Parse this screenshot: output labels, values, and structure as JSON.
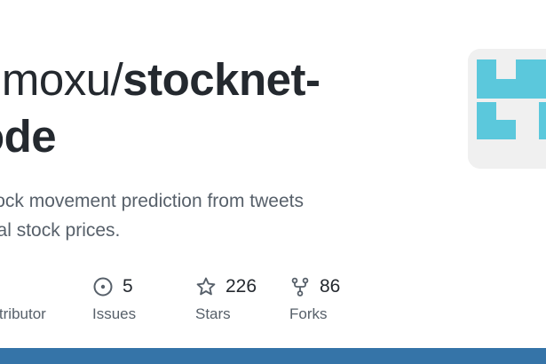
{
  "repo": {
    "owner_fragment": "umoxu/",
    "name_line1": "stocknet-",
    "name_line2": "ode",
    "description_line1": "e for stock movement prediction from tweets",
    "description_line2": "historical stock prices."
  },
  "stats": {
    "contributors": {
      "label": "ontributor"
    },
    "issues": {
      "value": "5",
      "label": "Issues",
      "icon": "issue-opened-icon"
    },
    "stars": {
      "value": "226",
      "label": "Stars",
      "icon": "star-icon"
    },
    "forks": {
      "value": "86",
      "label": "Forks",
      "icon": "repo-forked-icon"
    }
  },
  "colors": {
    "title": "#24292f",
    "muted": "#57606a",
    "avatar_teal": "#5bc8dc",
    "avatar_bg": "#f0f0f0",
    "bottom_bar": "#3574a8"
  }
}
